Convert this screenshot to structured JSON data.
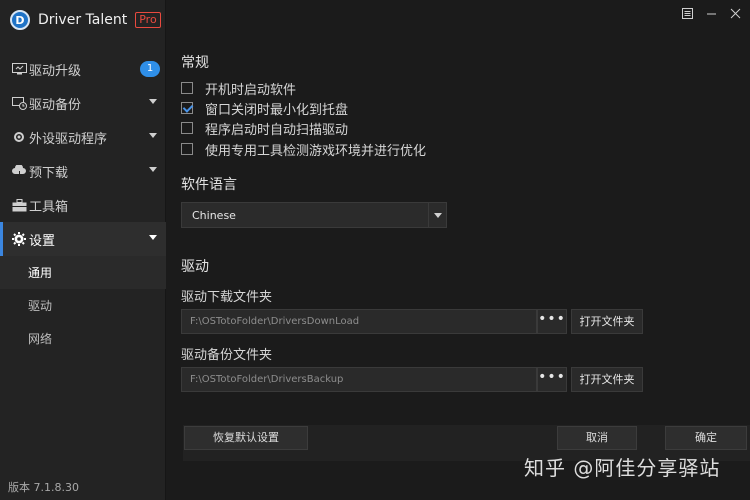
{
  "app": {
    "name": "Driver Talent",
    "edition": "Pro",
    "version": "版本 7.1.8.30"
  },
  "sidebar": {
    "items": [
      {
        "label": "驱动升级",
        "badge": "1",
        "icon": "monitor-icon"
      },
      {
        "label": "驱动备份",
        "icon": "backup-clock-icon"
      },
      {
        "label": "外设驱动程序",
        "icon": "gear-icon"
      },
      {
        "label": "预下载",
        "icon": "cloud-download-icon"
      },
      {
        "label": "工具箱",
        "icon": "toolbox-icon"
      },
      {
        "label": "设置",
        "icon": "settings-icon"
      }
    ],
    "sub_items": [
      {
        "label": "通用"
      },
      {
        "label": "驱动"
      },
      {
        "label": "网络"
      }
    ]
  },
  "general": {
    "title": "常规",
    "options": [
      {
        "label": "开机时启动软件",
        "checked": false
      },
      {
        "label": "窗口关闭时最小化到托盘",
        "checked": true
      },
      {
        "label": "程序启动时自动扫描驱动",
        "checked": false
      },
      {
        "label": "使用专用工具检测游戏环境并进行优化",
        "checked": false
      }
    ]
  },
  "language": {
    "title": "软件语言",
    "selected": "Chinese"
  },
  "driver": {
    "title": "驱动",
    "download_label": "驱动下载文件夹",
    "download_path": "F:\\OSTotoFolder\\DriversDownLoad",
    "backup_label": "驱动备份文件夹",
    "backup_path": "F:\\OSTotoFolder\\DriversBackup",
    "browse_label": "•••",
    "open_label": "打开文件夹"
  },
  "footer": {
    "reset": "恢复默认设置",
    "cancel": "取消",
    "ok": "确定"
  },
  "watermark": "知乎 @阿佳分享驿站",
  "colors": {
    "accent": "#3b86e0",
    "badge": "#2f8fe8",
    "pro": "#e84a3f",
    "background": "#1b1b1b",
    "sidebar": "#232323"
  }
}
